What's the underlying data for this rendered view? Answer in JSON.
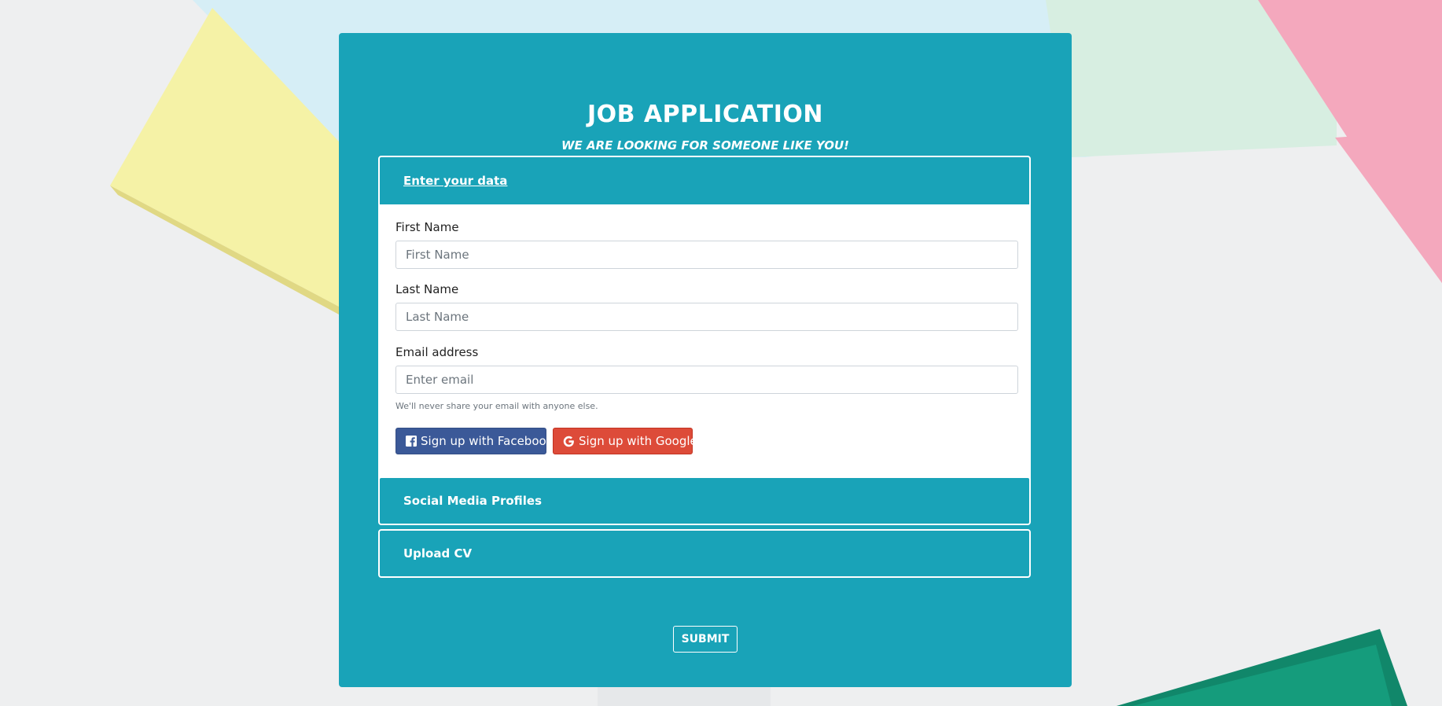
{
  "header": {
    "title": "JOB APPLICATION",
    "subtitle": "WE ARE LOOKING FOR SOMEONE LIKE YOU!"
  },
  "sections": {
    "enter_data": {
      "title": "Enter your data",
      "expanded": true
    },
    "social_media": {
      "title": "Social Media Profiles",
      "expanded": false
    },
    "upload_cv": {
      "title": "Upload CV",
      "expanded": false
    }
  },
  "form": {
    "first_name": {
      "label": "First Name",
      "placeholder": "First Name",
      "value": ""
    },
    "last_name": {
      "label": "Last Name",
      "placeholder": "Last Name",
      "value": ""
    },
    "email": {
      "label": "Email address",
      "placeholder": "Enter email",
      "value": "",
      "help": "We'll never share your email with anyone else."
    }
  },
  "buttons": {
    "facebook": {
      "label": "Sign up with Facebook",
      "icon": "facebook-icon",
      "color": "#3b5998"
    },
    "google": {
      "label": "Sign up with Google",
      "icon": "google-icon",
      "color": "#dd4b39"
    },
    "submit": "SUBMIT"
  },
  "colors": {
    "accent": "#19a3b8",
    "panel_border": "#ffffff"
  }
}
